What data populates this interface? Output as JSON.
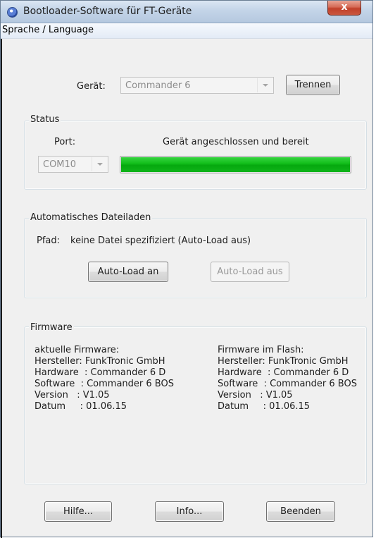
{
  "window": {
    "title": "Bootloader-Software für FT-Geräte",
    "close_glyph": "x"
  },
  "menu": {
    "language_label": "Sprache / Language"
  },
  "device": {
    "label": "Gerät:",
    "selected": "Commander 6",
    "disconnect_label": "Trennen"
  },
  "status": {
    "title": "Status",
    "port_label": "Port:",
    "port_value": "COM10",
    "message": "Gerät angeschlossen und bereit",
    "progress_percent": 100,
    "progress_color": "#14c01d"
  },
  "autoload": {
    "title": "Automatisches Dateiladen",
    "path_label": "Pfad:",
    "path_value": "keine Datei spezifiziert (Auto-Load aus)",
    "on_label": "Auto-Load an",
    "off_label": "Auto-Load aus"
  },
  "firmware": {
    "title": "Firmware",
    "current": {
      "heading": "aktuelle Firmware:",
      "manufacturer": "Hersteller: FunkTronic GmbH",
      "hardware": "Hardware  : Commander 6 D",
      "software": "Software  : Commander 6 BOS",
      "version": "Version   : V1.05",
      "date": "Datum     : 01.06.15"
    },
    "flash": {
      "heading": "Firmware im Flash:",
      "manufacturer": "Hersteller: FunkTronic GmbH",
      "hardware": "Hardware  : Commander 6 D",
      "software": "Software  : Commander 6 BOS",
      "version": "Version   : V1.05",
      "date": "Datum     : 01.06.15"
    }
  },
  "footer": {
    "help_label": "Hilfe...",
    "info_label": "Info...",
    "exit_label": "Beenden"
  },
  "icons": {
    "app": "globe-icon",
    "close": "close-icon",
    "dropdown": "chevron-down-icon"
  }
}
